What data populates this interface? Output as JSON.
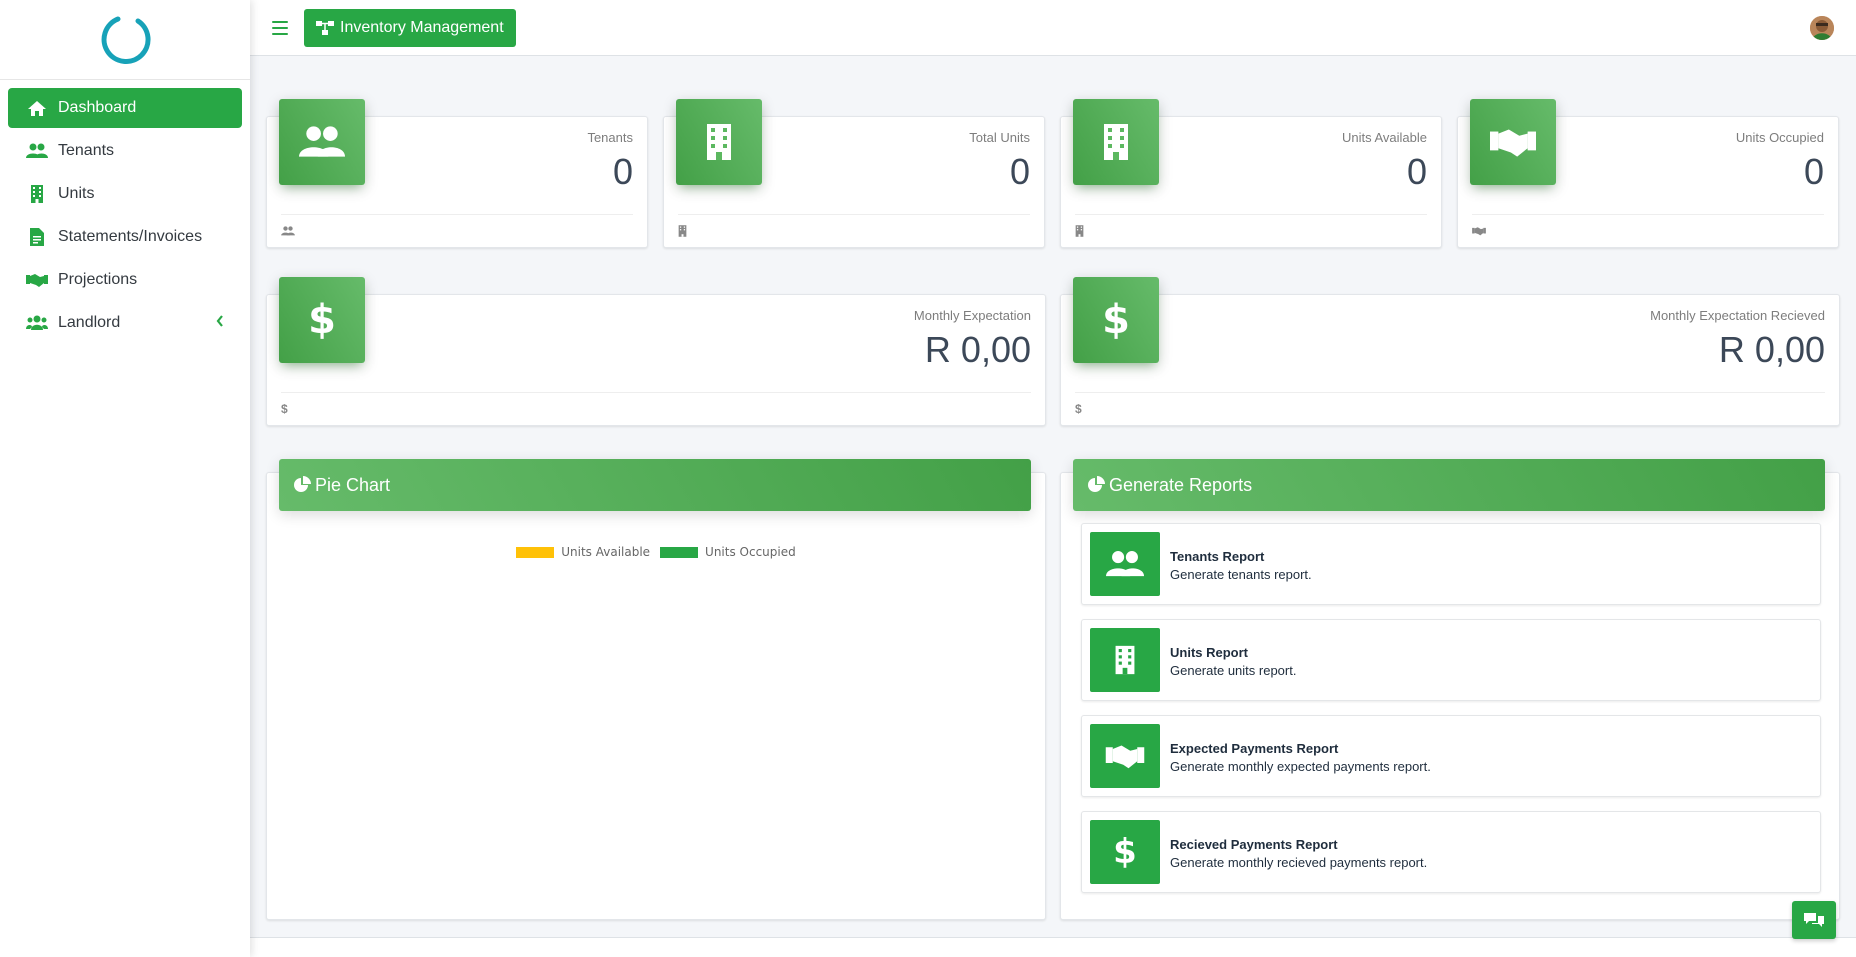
{
  "sidebar": {
    "items": [
      {
        "label": "Dashboard",
        "icon": "home-icon"
      },
      {
        "label": "Tenants",
        "icon": "users-icon"
      },
      {
        "label": "Units",
        "icon": "building-icon"
      },
      {
        "label": "Statements/Invoices",
        "icon": "file-invoice-icon"
      },
      {
        "label": "Projections",
        "icon": "handshake-icon"
      },
      {
        "label": "Landlord",
        "icon": "users-group-icon"
      }
    ]
  },
  "topbar": {
    "title": "Inventory Management"
  },
  "stats": [
    {
      "label": "Tenants",
      "value": "0",
      "icon": "users-icon"
    },
    {
      "label": "Total Units",
      "value": "0",
      "icon": "building-icon"
    },
    {
      "label": "Units Available",
      "value": "0",
      "icon": "building-icon"
    },
    {
      "label": "Units Occupied",
      "value": "0",
      "icon": "handshake-icon"
    }
  ],
  "money": [
    {
      "label": "Monthly Expectation",
      "value": "R 0,00",
      "icon": "dollar-icon"
    },
    {
      "label": "Monthly Expectation Recieved",
      "value": "R 0,00",
      "icon": "dollar-icon"
    }
  ],
  "pie_panel": {
    "title": "Pie Chart",
    "legend": [
      {
        "label": "Units Available",
        "color": "#ffc107"
      },
      {
        "label": "Units Occupied",
        "color": "#28a745"
      }
    ]
  },
  "reports_panel": {
    "title": "Generate Reports",
    "items": [
      {
        "title": "Tenants Report",
        "desc": "Generate tenants report.",
        "icon": "users-icon"
      },
      {
        "title": "Units Report",
        "desc": "Generate units report.",
        "icon": "building-icon"
      },
      {
        "title": "Expected Payments Report",
        "desc": "Generate monthly expected payments report.",
        "icon": "handshake-icon"
      },
      {
        "title": "Recieved Payments Report",
        "desc": "Generate monthly recieved payments report.",
        "icon": "dollar-icon"
      }
    ]
  },
  "colors": {
    "accent": "#28a745",
    "available": "#ffc107",
    "logo": "#17a2b8"
  }
}
